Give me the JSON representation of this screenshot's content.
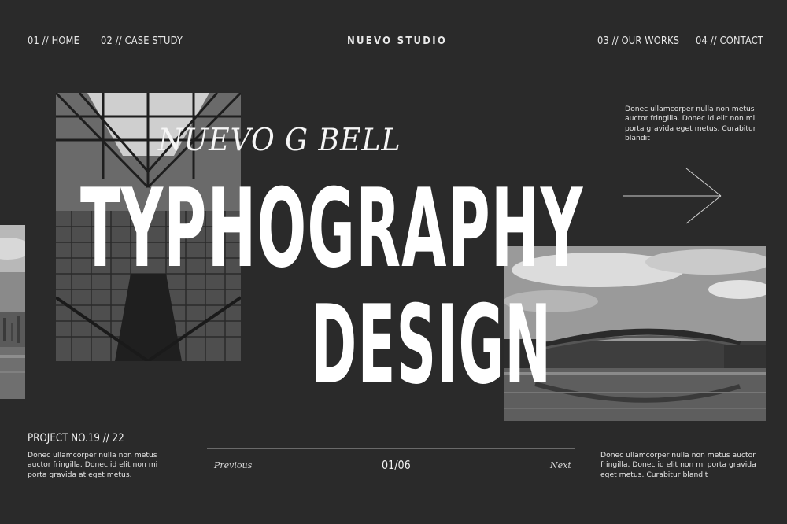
{
  "nav": {
    "left": [
      {
        "label": "01 // HOME"
      },
      {
        "label": "02 // CASE STUDY"
      }
    ],
    "brand": "NUEVO STUDIO",
    "right": [
      {
        "label": "03 // OUR WORKS"
      },
      {
        "label": "04 // CONTACT"
      }
    ]
  },
  "hero": {
    "script_title": "NUEVO G BELL",
    "headline_line1": "TYPHOGRAPHY",
    "headline_line2": "DESIGN"
  },
  "side_note": {
    "text": "Donec ullamcorper nulla non metus auctor fringilla. Donec id elit non mi porta gravida  eget metus. Curabitur blandit"
  },
  "project": {
    "label": "PROJECT NO.19 // 22",
    "text": "Donec ullamcorper nulla non metus auctor fringilla. Donec id elit non mi porta gravida at eget metus."
  },
  "pager": {
    "previous": "Previous",
    "count": "01/06",
    "next": "Next"
  },
  "footer_note": {
    "text": "Donec ullamcorper nulla non metus auctor fringilla. Donec id elit non mi porta gravida eget metus. Curabitur blandit"
  },
  "colors": {
    "background": "#2a2a2a",
    "text": "#ffffff",
    "divider": "#5a5a5a"
  },
  "icons": [
    "arrow-right-icon"
  ]
}
